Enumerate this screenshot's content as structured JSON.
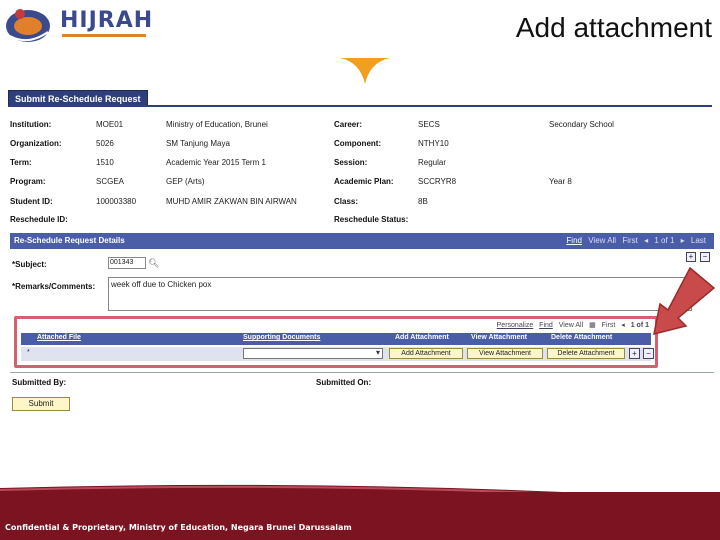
{
  "slide": {
    "title": "Add attachment",
    "logo_text": "HIJRAH",
    "footer": "Confidential & Proprietary, Ministry of Education, Negara Brunei Darussalam"
  },
  "tab_label": "Submit Re-Schedule Request",
  "info": {
    "institution": {
      "label": "Institution:",
      "code": "MOE01",
      "name": "Ministry of Education, Brunei"
    },
    "organization": {
      "label": "Organization:",
      "code": "5026",
      "name": "SM Tanjung Maya"
    },
    "term": {
      "label": "Term:",
      "code": "1510",
      "name": "Academic Year 2015 Term 1"
    },
    "program": {
      "label": "Program:",
      "code": "SCGEA",
      "name": "GEP (Arts)"
    },
    "student_id": {
      "label": "Student ID:",
      "code": "100003380",
      "name": "MUHD AMIR ZAKWAN BIN AIRWAN"
    },
    "reschedule_id": {
      "label": "Reschedule ID:"
    },
    "career": {
      "label": "Career:",
      "code": "SECS",
      "name": "Secondary School"
    },
    "component": {
      "label": "Component:",
      "code": "NTHY10"
    },
    "session": {
      "label": "Session:",
      "code": "Regular"
    },
    "academic_plan": {
      "label": "Academic Plan:",
      "code": "SCCRYR8",
      "name": "Year 8"
    },
    "class": {
      "label": "Class:",
      "code": "8B"
    },
    "reschedule_status": {
      "label": "Reschedule Status:"
    }
  },
  "details": {
    "header": "Re-Schedule Request Details",
    "nav": {
      "find": "Find",
      "view_all": "View All",
      "first": "First",
      "count": "1 of 1",
      "last": "Last"
    },
    "subject_label": "*Subject:",
    "subject_value": "001343",
    "remarks_label": "*Remarks/Comments:",
    "remarks_value": "week off due to Chicken pox"
  },
  "grid": {
    "nav": {
      "personalize": "Personalize",
      "find": "Find",
      "view_all": "View All",
      "first": "First",
      "count": "1 of 1"
    },
    "columns": [
      "Attached File",
      "Supporting Documents",
      "Add Attachment",
      "View Attachment",
      "Delete Attachment"
    ],
    "row_marker": "*",
    "buttons": {
      "add": "Add Attachment",
      "view": "View Attachment",
      "delete": "Delete Attachment"
    }
  },
  "footer_fields": {
    "submitted_by": "Submitted By:",
    "submitted_on": "Submitted On:",
    "submit_button": "Submit"
  },
  "colors": {
    "header_blue": "#4a5ea8",
    "highlight": "#d85f6f",
    "arrow": "#c84a4a",
    "footer": "#7b1420"
  }
}
